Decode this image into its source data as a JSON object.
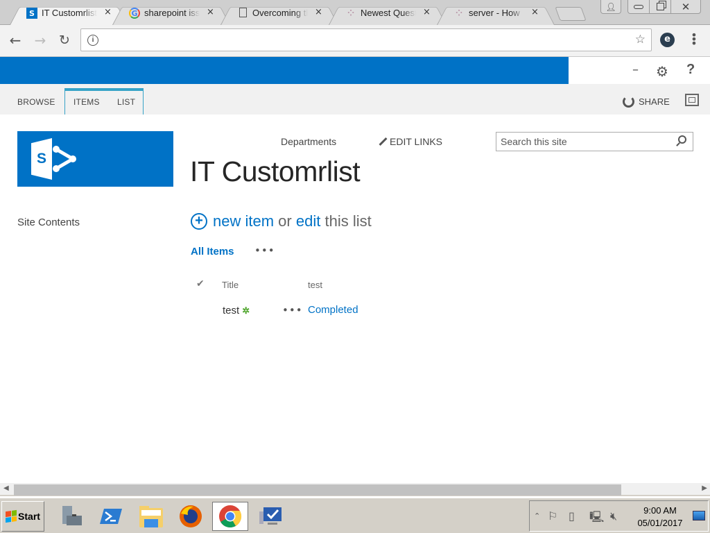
{
  "browser": {
    "tabs": [
      {
        "title": "IT Customrlist",
        "favicon": "sharepoint-icon",
        "active": true
      },
      {
        "title": "sharepoint issue",
        "favicon": "google-icon",
        "active": false
      },
      {
        "title": "Overcoming the",
        "favicon": "page-icon",
        "active": false
      },
      {
        "title": "Newest Questions",
        "favicon": "stackexchange-icon",
        "active": false
      },
      {
        "title": "server - How",
        "favicon": "stackexchange-icon",
        "active": false
      }
    ],
    "close_glyph": "×",
    "address": "",
    "ext_label": "e"
  },
  "ribbon": {
    "tabs": [
      "BROWSE",
      "ITEMS",
      "LIST"
    ],
    "share_label": "SHARE"
  },
  "site": {
    "top_nav_link": "Departments",
    "edit_links_label": "EDIT LINKS",
    "search_placeholder": "Search this site",
    "title": "IT Customrlist",
    "left_nav": [
      "Site Contents"
    ],
    "logo_letter": "S"
  },
  "list": {
    "new_item_label": "new item",
    "or_label": "or",
    "edit_label": "edit",
    "this_list_label": "this list",
    "view_name": "All Items",
    "ellipsis": "•••",
    "columns": [
      "Title",
      "test"
    ],
    "rows": [
      {
        "title": "test",
        "is_new": true,
        "new_glyph": "✲",
        "test": "Completed"
      }
    ]
  },
  "taskbar": {
    "start_label": "Start",
    "apps": [
      "server-manager",
      "powershell",
      "file-explorer",
      "firefox",
      "chrome",
      "remote-desktop"
    ],
    "active_app": "chrome",
    "time": "9:00 AM",
    "date": "05/01/2017"
  }
}
